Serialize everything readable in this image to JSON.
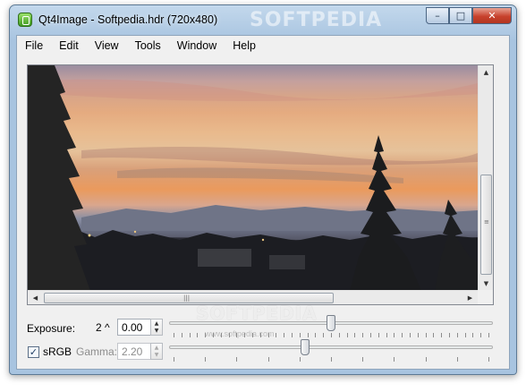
{
  "window": {
    "title": "Qt4Image - Softpedia.hdr (720x480)",
    "watermark": "SOFTPEDIA",
    "controls": {
      "minimize": "–",
      "maximize": "□",
      "close": "✕"
    }
  },
  "menu": [
    "File",
    "Edit",
    "View",
    "Tools",
    "Window",
    "Help"
  ],
  "image": {
    "description_icon": "hdr-image-sunset"
  },
  "scrollbars": {
    "up_arrow": "▲",
    "down_arrow": "▼",
    "left_arrow": "◀",
    "right_arrow": "▶",
    "grip": "|||",
    "grip_v": "≡"
  },
  "exposure": {
    "label": "Exposure:",
    "range_label": "2 ^",
    "value": "0.00",
    "slider_position": 0.5
  },
  "gamma": {
    "srgb_label": "sRGB",
    "srgb_checked": true,
    "checkmark": "✓",
    "label": "Gamma:",
    "value": "2.20",
    "slider_position": 0.42
  },
  "spin": {
    "up": "▲",
    "down": "▼"
  },
  "watermark_mid": "SOFTPEDIA",
  "watermark_url": "www.softpedia.com"
}
